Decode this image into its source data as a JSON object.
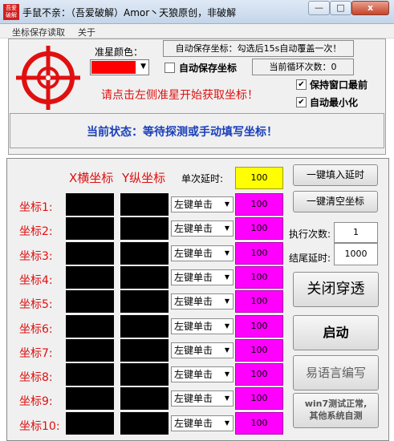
{
  "window": {
    "icon_text": "吾爱破解",
    "title": "手鼠不亲：（吾爱破解）Amor丶天狼原创，非破解",
    "minimize": "—",
    "maximize": "□",
    "close": "x"
  },
  "menu": [
    "坐标保存读取",
    "关于"
  ],
  "top": {
    "color_label": "准星颜色：",
    "color_value": "#ff0000",
    "autosave_hint": "自动保存坐标：勾选后15s自动覆盖一次！",
    "autosave_label": "自动保存坐标",
    "loop_label": "当前循环次数：0",
    "keep_top_label": "保持窗口最前",
    "auto_min_label": "自动最小化",
    "crosshair_hint": "请点击左侧准星开始获取坐标！",
    "status": "当前状态：等待探测或手动填写坐标！"
  },
  "grid": {
    "x_header": "X横坐标",
    "y_header": "Y纵坐标",
    "single_delay_label": "单次延时:",
    "single_delay_value": "100",
    "rows": [
      {
        "label": "坐标1:",
        "action": "左键单击",
        "delay": "100"
      },
      {
        "label": "坐标2:",
        "action": "左键单击",
        "delay": "100"
      },
      {
        "label": "坐标3:",
        "action": "左键单击",
        "delay": "100"
      },
      {
        "label": "坐标4:",
        "action": "左键单击",
        "delay": "100"
      },
      {
        "label": "坐标5:",
        "action": "左键单击",
        "delay": "100"
      },
      {
        "label": "坐标6:",
        "action": "左键单击",
        "delay": "100"
      },
      {
        "label": "坐标7:",
        "action": "左键单击",
        "delay": "100"
      },
      {
        "label": "坐标8:",
        "action": "左键单击",
        "delay": "100"
      },
      {
        "label": "坐标9:",
        "action": "左键单击",
        "delay": "100"
      },
      {
        "label": "坐标10:",
        "action": "左键单击",
        "delay": "100"
      }
    ]
  },
  "side": {
    "fill_delay": "一键填入延时",
    "clear_coords": "一键清空坐标",
    "exec_count_label": "执行次数:",
    "exec_count_value": "1",
    "tail_delay_label": "结尾延时:",
    "tail_delay_value": "1000",
    "toggle_passthrough": "关闭穿透",
    "start": "启动",
    "lang_label": "易语言编写",
    "win7_note_line1": "win7测试正常,",
    "win7_note_line2": "其他系统自测"
  }
}
